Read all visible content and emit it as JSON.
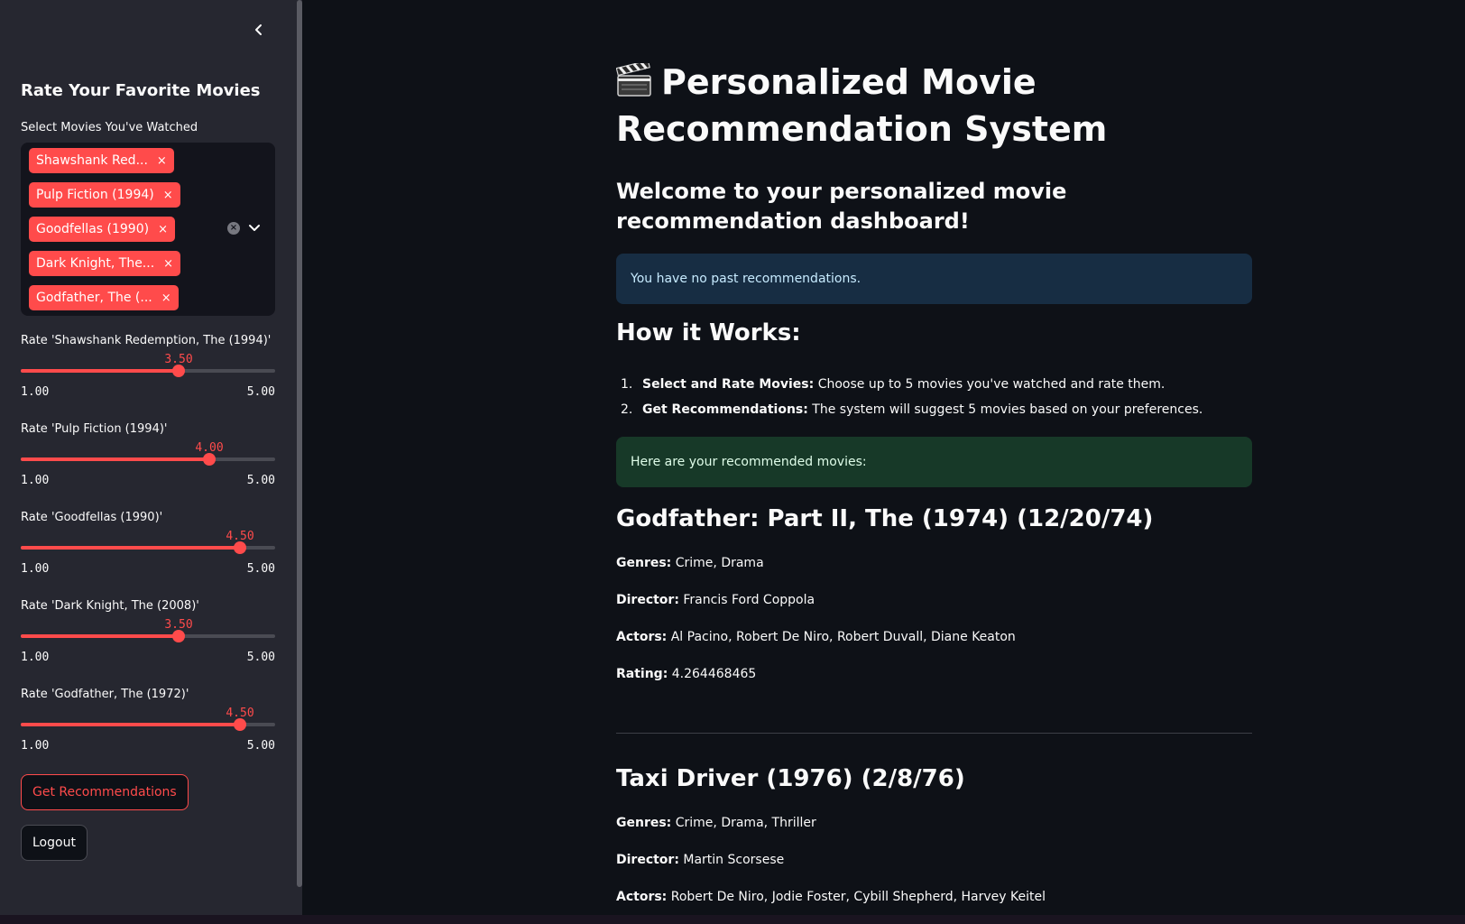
{
  "sidebar": {
    "collapse_icon": "chevron-left-icon",
    "title": "Rate Your Favorite Movies",
    "multiselect": {
      "label": "Select Movies You've Watched",
      "tags": [
        "Shawshank Red...",
        "Pulp Fiction (1994)",
        "Goodfellas (1990)",
        "Dark Knight, The...",
        "Godfather, The (..."
      ],
      "remove_icon": "×",
      "clear_icon": "clear-circle-icon",
      "dropdown_icon": "chevron-down-icon"
    },
    "sliders": [
      {
        "label": "Rate 'Shawshank Redemption, The (1994)'",
        "value": "3.50",
        "value_num": 3.5,
        "min": "1.00",
        "max": "5.00"
      },
      {
        "label": "Rate 'Pulp Fiction (1994)'",
        "value": "4.00",
        "value_num": 4.0,
        "min": "1.00",
        "max": "5.00"
      },
      {
        "label": "Rate 'Goodfellas (1990)'",
        "value": "4.50",
        "value_num": 4.5,
        "min": "1.00",
        "max": "5.00"
      },
      {
        "label": "Rate 'Dark Knight, The (2008)'",
        "value": "3.50",
        "value_num": 3.5,
        "min": "1.00",
        "max": "5.00"
      },
      {
        "label": "Rate 'Godfather, The (1972)'",
        "value": "4.50",
        "value_num": 4.5,
        "min": "1.00",
        "max": "5.00"
      }
    ],
    "recommend_button": "Get Recommendations",
    "logout_button": "Logout"
  },
  "main": {
    "title_icon": "clapper-board-icon",
    "title": "Personalized Movie Recommendation System",
    "welcome": "Welcome to your personalized movie recommendation dashboard!",
    "info": "You have no past recommendations.",
    "how_title": "How it Works:",
    "steps": [
      {
        "num": "1.",
        "bold": "Select and Rate Movies:",
        "text": " Choose up to 5 movies you've watched and rate them."
      },
      {
        "num": "2.",
        "bold": "Get Recommendations:",
        "text": " The system will suggest 5 movies based on your preferences."
      }
    ],
    "success": "Here are your recommended movies:",
    "movies": [
      {
        "title": "Godfather: Part II, The (1974) (12/20/74)",
        "genres_label": "Genres:",
        "genres": " Crime, Drama",
        "director_label": "Director:",
        "director": " Francis Ford Coppola",
        "actors_label": "Actors:",
        "actors": " Al Pacino, Robert De Niro, Robert Duvall, Diane Keaton",
        "rating_label": "Rating:",
        "rating": " 4.264468465"
      },
      {
        "title": "Taxi Driver (1976) (2/8/76)",
        "genres_label": "Genres:",
        "genres": " Crime, Drama, Thriller",
        "director_label": "Director:",
        "director": " Martin Scorsese",
        "actors_label": "Actors:",
        "actors": " Robert De Niro, Jodie Foster, Cybill Shepherd, Harvey Keitel"
      }
    ]
  },
  "colors": {
    "accent": "#ff4b4b",
    "sidebar_bg": "#262730",
    "main_bg": "#0e1117",
    "info_bg": "#172d43",
    "success_bg": "#173928"
  }
}
